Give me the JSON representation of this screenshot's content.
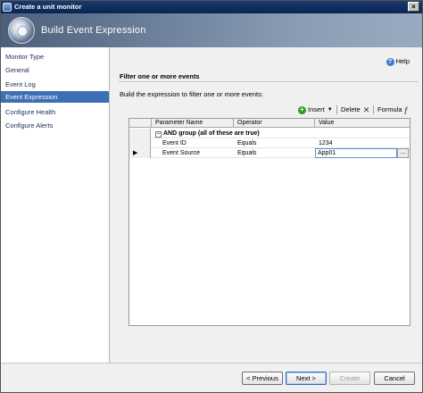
{
  "window": {
    "title": "Create a unit monitor"
  },
  "banner": {
    "title": "Build Event Expression"
  },
  "sidebar": {
    "items": [
      {
        "label": "Monitor Type"
      },
      {
        "label": "General"
      },
      {
        "label": "Event Log"
      },
      {
        "label": "Event Expression",
        "active": true
      },
      {
        "label": "Configure Health"
      },
      {
        "label": "Configure Alerts"
      }
    ]
  },
  "content": {
    "help_label": "Help",
    "section_title": "Filter one or more events",
    "instructions": "Build the expression to filter one or more events:"
  },
  "toolbar": {
    "insert_label": "Insert",
    "delete_label": "Delete",
    "formula_label": "Formula"
  },
  "grid": {
    "columns": [
      "Parameter Name",
      "Operator",
      "Value"
    ],
    "group_label": "AND group (all of these are true)",
    "rows": [
      {
        "parameter": "Event ID",
        "operator": "Equals",
        "value": "1234"
      },
      {
        "parameter": "Event Source",
        "operator": "Equals",
        "value": "App01"
      }
    ],
    "ellipsis": "..."
  },
  "footer": {
    "previous_label": "< Previous",
    "next_label": "Next >",
    "create_label": "Create",
    "cancel_label": "Cancel"
  },
  "colors": {
    "titlebar": "#0a2352",
    "active_nav": "#3d6fb6",
    "banner": "#6b7f9b"
  },
  "icons": [
    "app-icon",
    "close-icon",
    "help-icon",
    "insert-icon",
    "dropdown-icon",
    "delete-icon",
    "formula-icon",
    "collapse-icon",
    "row-pointer-icon"
  ]
}
